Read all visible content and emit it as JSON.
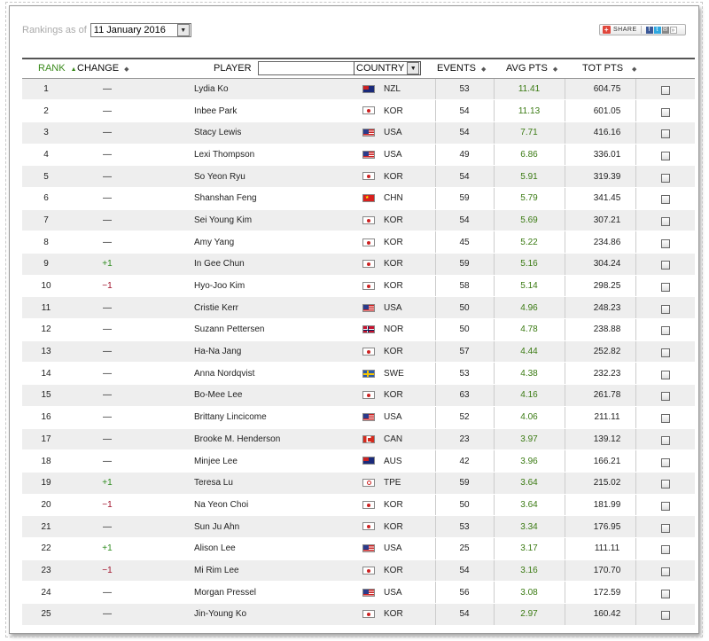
{
  "header": {
    "rankings_label": "Rankings as of",
    "date_value": "11 January 2016",
    "share_label": "SHARE"
  },
  "columns": {
    "rank": "RANK",
    "change": "CHANGE",
    "player": "PLAYER",
    "player_filter_value": "",
    "country": "COUNTRY",
    "events": "EVENTS",
    "avg_pts": "AVG PTS",
    "tot_pts": "TOT PTS"
  },
  "icons": {
    "sort": "sort-arrows-icon",
    "dropdown": "chevron-down-icon",
    "clear": "close-icon",
    "share": "plus-icon"
  },
  "colors": {
    "rank_header": "#3a8a1c",
    "avg_pts": "#3a7a12",
    "change_up": "#2e8b1e",
    "change_down": "#a0112a"
  },
  "rows": [
    {
      "rank": "1",
      "change": "—",
      "player": "Lydia Ko",
      "flag": "NZL",
      "country": "NZL",
      "events": "53",
      "avg": "11.41",
      "tot": "604.75"
    },
    {
      "rank": "2",
      "change": "—",
      "player": "Inbee Park",
      "flag": "KOR",
      "country": "KOR",
      "events": "54",
      "avg": "11.13",
      "tot": "601.05"
    },
    {
      "rank": "3",
      "change": "—",
      "player": "Stacy Lewis",
      "flag": "USA",
      "country": "USA",
      "events": "54",
      "avg": "7.71",
      "tot": "416.16"
    },
    {
      "rank": "4",
      "change": "—",
      "player": "Lexi Thompson",
      "flag": "USA",
      "country": "USA",
      "events": "49",
      "avg": "6.86",
      "tot": "336.01"
    },
    {
      "rank": "5",
      "change": "—",
      "player": "So Yeon Ryu",
      "flag": "KOR",
      "country": "KOR",
      "events": "54",
      "avg": "5.91",
      "tot": "319.39"
    },
    {
      "rank": "6",
      "change": "—",
      "player": "Shanshan Feng",
      "flag": "CHN",
      "country": "CHN",
      "events": "59",
      "avg": "5.79",
      "tot": "341.45"
    },
    {
      "rank": "7",
      "change": "—",
      "player": "Sei Young Kim",
      "flag": "KOR",
      "country": "KOR",
      "events": "54",
      "avg": "5.69",
      "tot": "307.21"
    },
    {
      "rank": "8",
      "change": "—",
      "player": "Amy Yang",
      "flag": "KOR",
      "country": "KOR",
      "events": "45",
      "avg": "5.22",
      "tot": "234.86"
    },
    {
      "rank": "9",
      "change": "+1",
      "player": "In Gee Chun",
      "flag": "KOR",
      "country": "KOR",
      "events": "59",
      "avg": "5.16",
      "tot": "304.24"
    },
    {
      "rank": "10",
      "change": "−1",
      "player": "Hyo-Joo Kim",
      "flag": "KOR",
      "country": "KOR",
      "events": "58",
      "avg": "5.14",
      "tot": "298.25"
    },
    {
      "rank": "11",
      "change": "—",
      "player": "Cristie Kerr",
      "flag": "USA",
      "country": "USA",
      "events": "50",
      "avg": "4.96",
      "tot": "248.23"
    },
    {
      "rank": "12",
      "change": "—",
      "player": "Suzann Pettersen",
      "flag": "NOR",
      "country": "NOR",
      "events": "50",
      "avg": "4.78",
      "tot": "238.88"
    },
    {
      "rank": "13",
      "change": "—",
      "player": "Ha-Na Jang",
      "flag": "KOR",
      "country": "KOR",
      "events": "57",
      "avg": "4.44",
      "tot": "252.82"
    },
    {
      "rank": "14",
      "change": "—",
      "player": "Anna Nordqvist",
      "flag": "SWE",
      "country": "SWE",
      "events": "53",
      "avg": "4.38",
      "tot": "232.23"
    },
    {
      "rank": "15",
      "change": "—",
      "player": "Bo-Mee Lee",
      "flag": "KOR",
      "country": "KOR",
      "events": "63",
      "avg": "4.16",
      "tot": "261.78"
    },
    {
      "rank": "16",
      "change": "—",
      "player": "Brittany Lincicome",
      "flag": "USA",
      "country": "USA",
      "events": "52",
      "avg": "4.06",
      "tot": "211.11"
    },
    {
      "rank": "17",
      "change": "—",
      "player": "Brooke M. Henderson",
      "flag": "CAN",
      "country": "CAN",
      "events": "23",
      "avg": "3.97",
      "tot": "139.12"
    },
    {
      "rank": "18",
      "change": "—",
      "player": "Minjee Lee",
      "flag": "AUS",
      "country": "AUS",
      "events": "42",
      "avg": "3.96",
      "tot": "166.21"
    },
    {
      "rank": "19",
      "change": "+1",
      "player": "Teresa Lu",
      "flag": "TPE",
      "country": "TPE",
      "events": "59",
      "avg": "3.64",
      "tot": "215.02"
    },
    {
      "rank": "20",
      "change": "−1",
      "player": "Na Yeon Choi",
      "flag": "KOR",
      "country": "KOR",
      "events": "50",
      "avg": "3.64",
      "tot": "181.99"
    },
    {
      "rank": "21",
      "change": "—",
      "player": "Sun Ju Ahn",
      "flag": "KOR",
      "country": "KOR",
      "events": "53",
      "avg": "3.34",
      "tot": "176.95"
    },
    {
      "rank": "22",
      "change": "+1",
      "player": "Alison Lee",
      "flag": "USA",
      "country": "USA",
      "events": "25",
      "avg": "3.17",
      "tot": "111.11"
    },
    {
      "rank": "23",
      "change": "−1",
      "player": "Mi Rim Lee",
      "flag": "KOR",
      "country": "KOR",
      "events": "54",
      "avg": "3.16",
      "tot": "170.70"
    },
    {
      "rank": "24",
      "change": "—",
      "player": "Morgan Pressel",
      "flag": "USA",
      "country": "USA",
      "events": "56",
      "avg": "3.08",
      "tot": "172.59"
    },
    {
      "rank": "25",
      "change": "—",
      "player": "Jin-Young Ko",
      "flag": "KOR",
      "country": "KOR",
      "events": "54",
      "avg": "2.97",
      "tot": "160.42"
    }
  ]
}
